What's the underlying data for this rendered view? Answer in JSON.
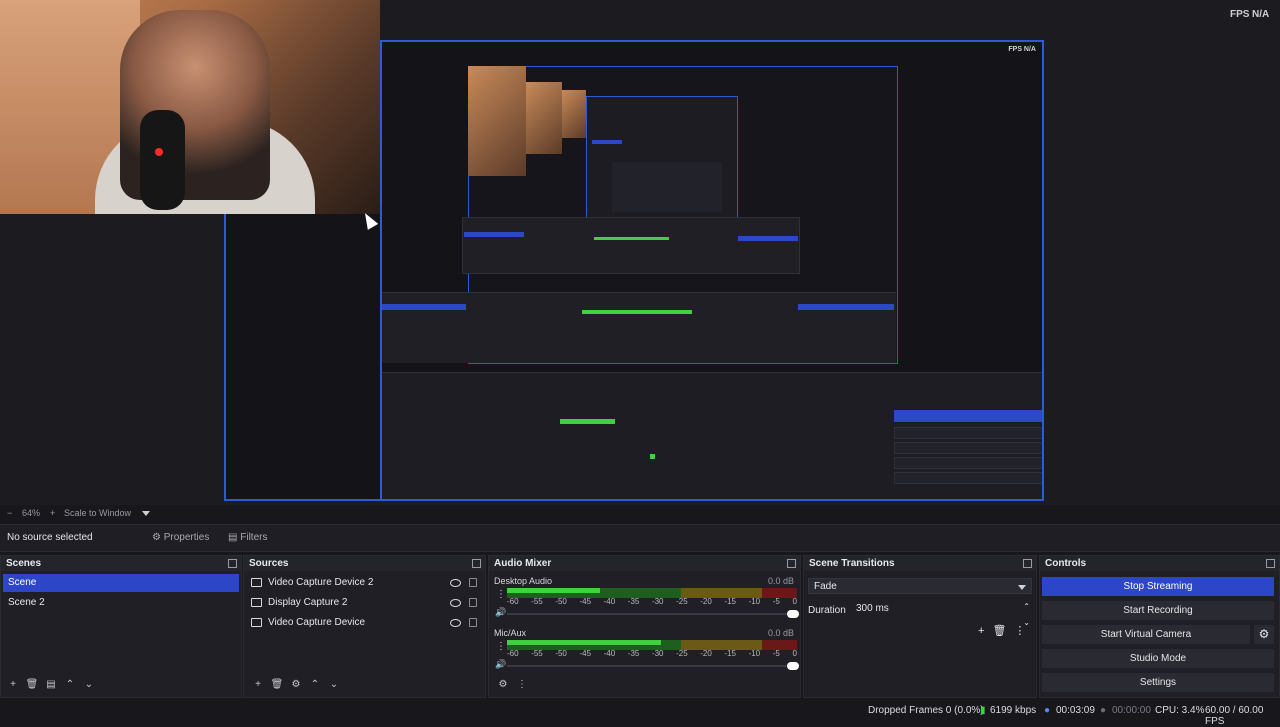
{
  "preview": {
    "fps_label": "FPS",
    "fps_value": "N/A",
    "zoom": "64%",
    "scale_mode": "Scale to Window"
  },
  "properties_bar": {
    "no_source": "No source selected",
    "properties": "Properties",
    "filters": "Filters"
  },
  "scenes": {
    "title": "Scenes",
    "items": [
      {
        "label": "Scene",
        "selected": true
      },
      {
        "label": "Scene 2",
        "selected": false
      }
    ]
  },
  "sources": {
    "title": "Sources",
    "items": [
      {
        "label": "Video Capture Device 2",
        "icon": "camera-icon"
      },
      {
        "label": "Display Capture 2",
        "icon": "monitor-icon"
      },
      {
        "label": "Video Capture Device",
        "icon": "camera-icon"
      }
    ]
  },
  "audio_mixer": {
    "title": "Audio Mixer",
    "ticks": [
      "-60",
      "-55",
      "-50",
      "-45",
      "-40",
      "-35",
      "-30",
      "-25",
      "-20",
      "-15",
      "-10",
      "-5",
      "0"
    ],
    "channels": [
      {
        "name": "Desktop Audio",
        "db": "0.0 dB",
        "level": 0.32
      },
      {
        "name": "Mic/Aux",
        "db": "0.0 dB",
        "level": 0.53
      }
    ]
  },
  "scene_transitions": {
    "title": "Scene Transitions",
    "transition": "Fade",
    "duration_label": "Duration",
    "duration_value": "300 ms"
  },
  "controls": {
    "title": "Controls",
    "buttons": [
      "Stop Streaming",
      "Start Recording",
      "Start Virtual Camera",
      "Studio Mode",
      "Settings"
    ]
  },
  "status": {
    "dropped_frames": "Dropped Frames 0 (0.0%)",
    "bitrate": "6199 kbps",
    "stream_time": "00:03:09",
    "record_time": "00:00:00",
    "cpu": "CPU: 3.4%",
    "fps": "60.00 / 60.00 FPS"
  },
  "colors": {
    "accent": "#2d46c8",
    "preview_border": "#2b5bd7",
    "meter_green": "#3fd13f"
  }
}
